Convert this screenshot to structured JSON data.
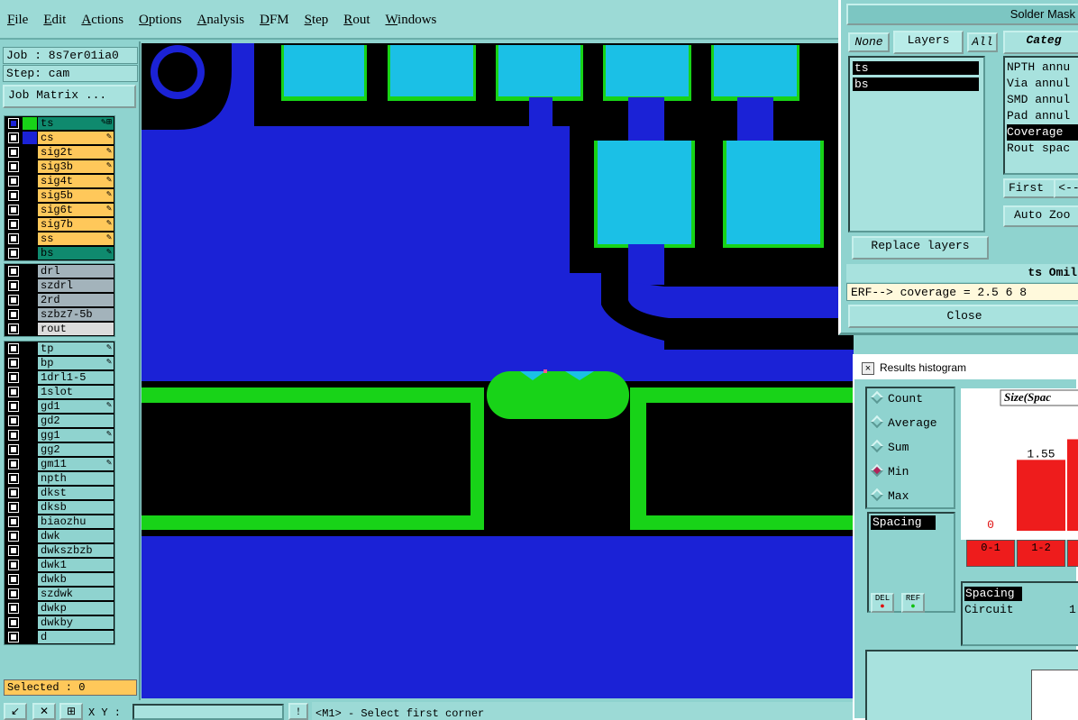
{
  "menu": [
    "File",
    "Edit",
    "Actions",
    "Options",
    "Analysis",
    "DFM",
    "Step",
    "Rout",
    "Windows"
  ],
  "left": {
    "job": "Job : 8s7er01ia0",
    "step": "Step: cam",
    "job_matrix_button": "Job Matrix ...",
    "selected": "Selected : 0"
  },
  "layers_group1": [
    {
      "name": "ts",
      "color": "#0f8a6e",
      "swatch": "#18d318",
      "icon": "✎⊞"
    },
    {
      "name": "cs",
      "color": "#ffc85a",
      "swatch": "#1b22d6",
      "icon": "✎"
    },
    {
      "name": "sig2t",
      "color": "#ffc85a",
      "swatch": "",
      "icon": "✎"
    },
    {
      "name": "sig3b",
      "color": "#ffc85a",
      "swatch": "",
      "icon": "✎"
    },
    {
      "name": "sig4t",
      "color": "#ffc85a",
      "swatch": "",
      "icon": "✎"
    },
    {
      "name": "sig5b",
      "color": "#ffc85a",
      "swatch": "",
      "icon": "✎"
    },
    {
      "name": "sig6t",
      "color": "#ffc85a",
      "swatch": "",
      "icon": "✎"
    },
    {
      "name": "sig7b",
      "color": "#ffc85a",
      "swatch": "",
      "icon": "✎"
    },
    {
      "name": "ss",
      "color": "#ffc85a",
      "swatch": "",
      "icon": "✎"
    },
    {
      "name": "bs",
      "color": "#0f8a6e",
      "swatch": "",
      "icon": "✎"
    }
  ],
  "layers_group2": [
    {
      "name": "drl",
      "color": "#a3b3bb",
      "icon": ""
    },
    {
      "name": "szdrl",
      "color": "#a3b3bb",
      "icon": ""
    },
    {
      "name": "2rd",
      "color": "#a3b3bb",
      "icon": ""
    },
    {
      "name": "szbz7-5b",
      "color": "#a3b3bb",
      "icon": ""
    },
    {
      "name": "rout",
      "color": "#dcdcdc",
      "icon": ""
    }
  ],
  "layers_group3": [
    {
      "name": "tp",
      "icon": "✎"
    },
    {
      "name": "bp",
      "icon": "✎"
    },
    {
      "name": "1drl1-5",
      "icon": ""
    },
    {
      "name": "1slot",
      "icon": ""
    },
    {
      "name": "gd1",
      "icon": "✎"
    },
    {
      "name": "gd2",
      "icon": ""
    },
    {
      "name": "gg1",
      "icon": "✎"
    },
    {
      "name": "gg2",
      "icon": ""
    },
    {
      "name": "gm11",
      "icon": "✎"
    },
    {
      "name": "npth",
      "icon": ""
    },
    {
      "name": "dkst",
      "icon": ""
    },
    {
      "name": "dksb",
      "icon": ""
    },
    {
      "name": "biaozhu",
      "icon": ""
    },
    {
      "name": "dwk",
      "icon": ""
    },
    {
      "name": "dwkszbzb",
      "icon": ""
    },
    {
      "name": "dwk1",
      "icon": ""
    },
    {
      "name": "dwkb",
      "icon": ""
    },
    {
      "name": "szdwk",
      "icon": ""
    },
    {
      "name": "dwkp",
      "icon": ""
    },
    {
      "name": "dwkby",
      "icon": ""
    },
    {
      "name": "d",
      "icon": ""
    }
  ],
  "status": {
    "xy_label": "X Y :",
    "message": "<M1> - Select first corner"
  },
  "solder_mask": {
    "title": "Solder Mask",
    "none": "None",
    "layers_tab": "Layers",
    "all": "All",
    "category": "Categ",
    "layers": [
      "ts",
      "bs"
    ],
    "categories": [
      "NPTH annu",
      "Via annul",
      "SMD annul",
      "Pad annul",
      "Coverage",
      "Rout spac"
    ],
    "first": "First",
    "prev": "<--",
    "auto_zoom": "Auto Zoo",
    "replace_layers": "Replace layers",
    "omil": "ts Omil",
    "erf": "ERF--> coverage = 2.5 6 8",
    "close": "Close"
  },
  "histogram": {
    "title": "Results histogram",
    "modes": [
      "Count",
      "Average",
      "Sum",
      "Min",
      "Max"
    ],
    "selected_mode": "Min",
    "list_item": "Spacing",
    "del": "DEL",
    "ref": "REF",
    "chart_title": "Size(Spac",
    "bottom_items": [
      "Spacing",
      "Circuit"
    ],
    "bottom_value": "1"
  },
  "chart_data": {
    "type": "bar",
    "title": "Size(Spac",
    "categories": [
      "0-1",
      "1-2",
      ""
    ],
    "values": [
      0,
      1.55,
      2
    ],
    "data_labels": [
      "0",
      "1.55",
      "2"
    ],
    "bar_color": "#ee1c1c"
  }
}
